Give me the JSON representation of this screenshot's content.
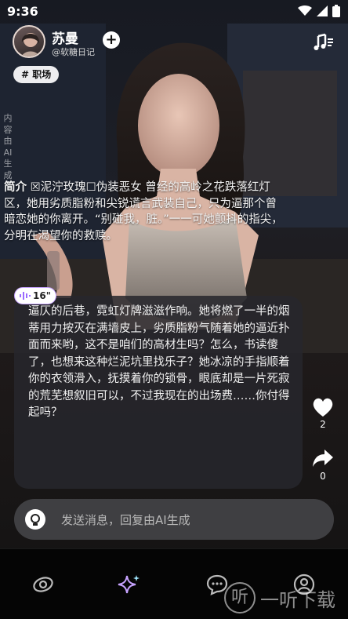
{
  "status_bar": {
    "time": "9:36"
  },
  "profile": {
    "name": "苏曼",
    "handle": "@软糖日记"
  },
  "tag": "# 职场",
  "ai_note": "内容由AI生成",
  "intro": {
    "label": "简介",
    "text": " ☒泥泞玫瑰☐伪装恶女 曾经的高岭之花跌落红灯区，她用劣质脂粉和尖锐谎言武装自己，只为逼那个曾暗恋她的你离开。“别碰我，脏。”一一可她颤抖的指尖，分明在渴望你的救赎。"
  },
  "dialog": {
    "badge": "16\"",
    "text": "逼仄的后巷，霓虹灯牌滋滋作响。她将燃了一半的烟蒂用力按灭在满墙皮上，劣质脂粉气随着她的逼近扑面而来哟，这不是咱们的高材生吗？怎么，书读傻了，也想来这种烂泥坑里找乐子？她冰凉的手指顺着你的衣领滑入，抚摸着你的锁骨，眼底却是一片死寂的荒芜想叙旧可以，不过我现在的出场费……你付得起吗？"
  },
  "actions": {
    "like_count": "2",
    "share_count": "0"
  },
  "input": {
    "placeholder": "发送消息，回复由AI生成"
  },
  "watermark": {
    "glyph": "听",
    "text": "一听下载"
  },
  "icons": {
    "status": [
      "wifi-icon",
      "signal-icon",
      "battery-icon"
    ],
    "header": [
      "add-icon",
      "music-icon"
    ],
    "nav": [
      "discover-icon",
      "sparkle-icon",
      "chat-icon",
      "profile-icon"
    ],
    "actions": [
      "heart-icon",
      "share-icon"
    ]
  },
  "colors": {
    "accent_badge": "#c7a3ff",
    "card_bg": "#26262c"
  }
}
